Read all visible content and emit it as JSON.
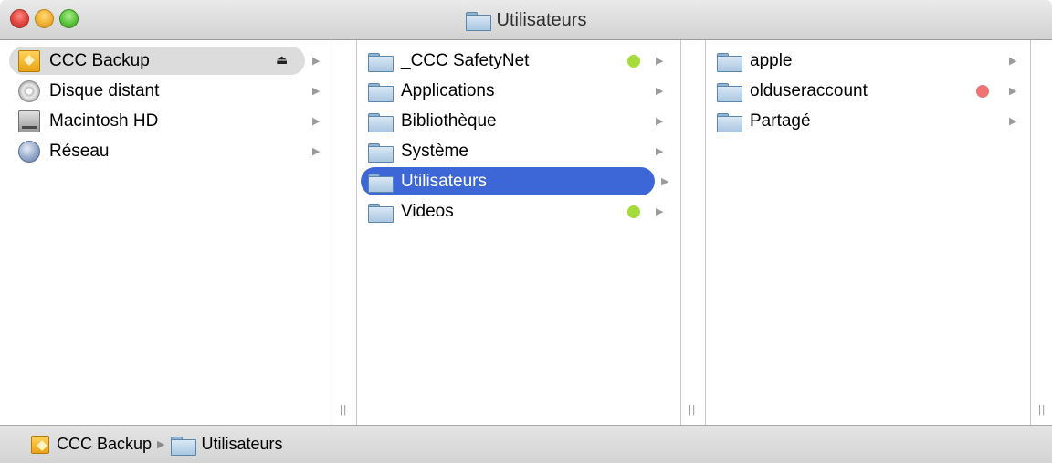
{
  "window": {
    "title": "Utilisateurs"
  },
  "sidebar": {
    "items": [
      {
        "label": "CCC Backup",
        "icon": "backup-drive-icon",
        "selected": true,
        "eject": true
      },
      {
        "label": "Disque distant",
        "icon": "remote-disc-icon"
      },
      {
        "label": "Macintosh HD",
        "icon": "hard-drive-icon"
      },
      {
        "label": "Réseau",
        "icon": "network-globe-icon"
      }
    ]
  },
  "column2": {
    "items": [
      {
        "label": "_CCC SafetyNet",
        "tag": "green"
      },
      {
        "label": "Applications"
      },
      {
        "label": "Bibliothèque"
      },
      {
        "label": "Système"
      },
      {
        "label": "Utilisateurs",
        "selected": true
      },
      {
        "label": "Videos",
        "tag": "green"
      }
    ]
  },
  "column3": {
    "items": [
      {
        "label": "apple"
      },
      {
        "label": "olduseraccount",
        "tag": "red"
      },
      {
        "label": "Partagé"
      }
    ]
  },
  "pathbar": {
    "segments": [
      {
        "label": "CCC Backup",
        "icon": "backup-drive-icon"
      },
      {
        "label": "Utilisateurs",
        "icon": "folder-icon"
      }
    ]
  },
  "colors": {
    "selection_blue": "#3d67d6",
    "selection_gray": "#dcdcdc",
    "tag_green": "#a4dc3c",
    "tag_red": "#ee7474"
  }
}
